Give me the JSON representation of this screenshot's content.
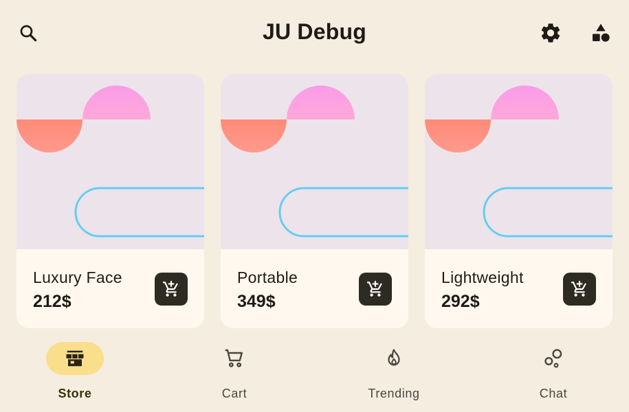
{
  "app": {
    "title": "JU Debug"
  },
  "topbar": {
    "search_icon": "search-icon",
    "settings_icon": "gear-icon",
    "categories_icon": "shapes-icon"
  },
  "colors": {
    "background": "#f5ede0",
    "card_art_bg": "#ece4ea",
    "card_info_bg": "#fff8ee",
    "cart_button": "#2e2b22",
    "nav_active_pill": "#f9df8c",
    "shape_pink": "#fa9cea",
    "shape_coral": "#ff8f80",
    "shape_outline": "#66ccf5"
  },
  "products": [
    {
      "name": "Luxury Face",
      "price": "212$"
    },
    {
      "name": "Portable",
      "price": "349$"
    },
    {
      "name": "Lightweight",
      "price": "292$"
    }
  ],
  "nav": {
    "items": [
      {
        "label": "Store",
        "icon": "storefront-icon",
        "active": true
      },
      {
        "label": "Cart",
        "icon": "cart-icon",
        "active": false
      },
      {
        "label": "Trending",
        "icon": "flame-icon",
        "active": false
      },
      {
        "label": "Chat",
        "icon": "bubbles-icon",
        "active": false
      }
    ]
  }
}
